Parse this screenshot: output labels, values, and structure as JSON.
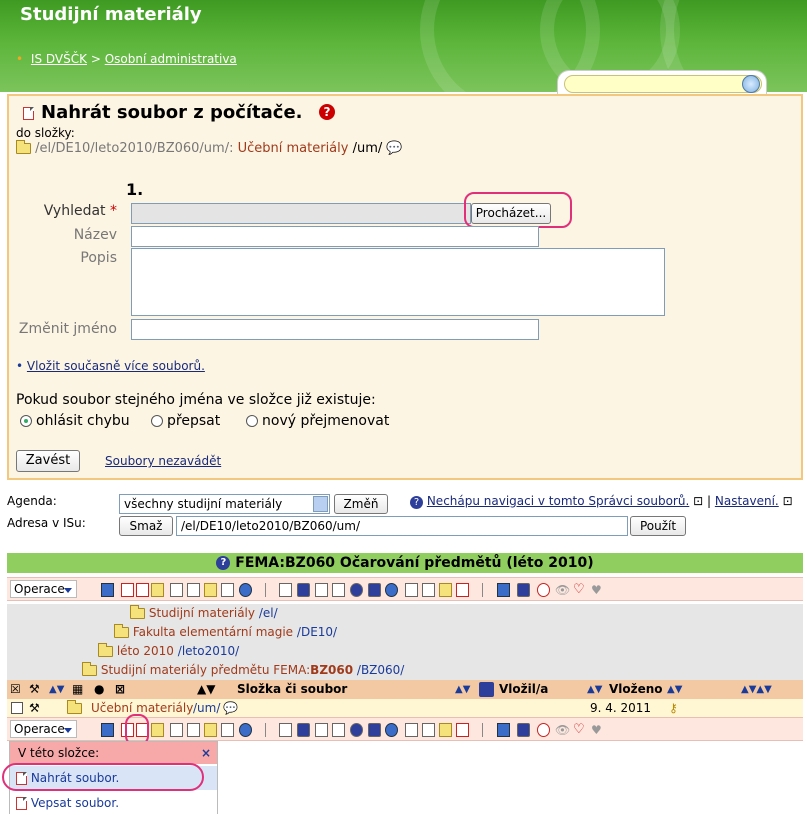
{
  "header": {
    "title": "Studijní materiály",
    "breadcrumb": [
      "IS DVŠČK",
      "Osobní administrativa"
    ],
    "breadcrumb_sep": ">",
    "search_placeholder": ""
  },
  "upload": {
    "title": "Nahrát soubor z počítače.",
    "to_folder_label": "do složky:",
    "folder_path": "/el/DE10/leto2010/BZ060/um/:",
    "folder_name": "Učební materiály",
    "folder_short": "/um/",
    "step": "1.",
    "fields": {
      "find_label": "Vyhledat",
      "required_mark": "*",
      "browse_button": "Procházet...",
      "name_label": "Název",
      "desc_label": "Popis",
      "rename_label": "Změnit jméno"
    },
    "multi_link": "Vložit současně více souborů.",
    "exists_question": "Pokud soubor stejného jména ve složce již existuje:",
    "options": [
      "ohlásit chybu",
      "přepsat",
      "nový přejmenovat"
    ],
    "selected_option": "ohlásit chybu",
    "submit_button": "Zavést",
    "cancel_link": "Soubory nezavádět"
  },
  "agenda": {
    "agenda_label": "Agenda:",
    "agenda_value": "všechny studijní materiály",
    "change_button": "Změň",
    "help_link": "Nechápu navigaci v tomto Správci souborů.",
    "settings_link": "Nastavení.",
    "address_label": "Adresa v ISu:",
    "clear_button": "Smaž",
    "address_value": "/el/DE10/leto2010/BZ060/um/",
    "use_button": "Použít"
  },
  "course": {
    "title": "FEMA:BZ060 Očarování předmětů (léto 2010)",
    "operations_label": "Operace"
  },
  "tree": [
    {
      "name": "Studijní materiály",
      "path": "/el/"
    },
    {
      "name": "Fakulta elementární magie",
      "path": "/DE10/"
    },
    {
      "name": "léto 2010",
      "path": "/leto2010/"
    },
    {
      "name_prefix": "Studijní materiály předmětu FEMA:",
      "name_bold": "BZ060",
      "path": "/BZ060/"
    }
  ],
  "list_header": {
    "column_file": "Složka či soubor",
    "column_inserted_by": "Vložil/a",
    "column_inserted": "Vloženo"
  },
  "file_row": {
    "name": "Učební materiály",
    "path": "/um/",
    "date": "9. 4. 2011"
  },
  "menu": {
    "header": "V této složce:",
    "close": "×",
    "items": [
      "Nahrát soubor.",
      "Vepsat soubor."
    ]
  },
  "colors": {
    "header_green": "#5cb53a",
    "panel_bg": "#fdf5e4",
    "course_bar": "#8fce5f",
    "highlight": "#e0307a"
  }
}
